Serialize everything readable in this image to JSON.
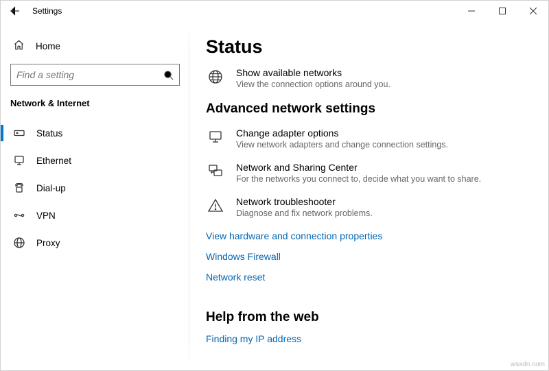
{
  "titlebar": {
    "title": "Settings"
  },
  "sidebar": {
    "home_label": "Home",
    "search_placeholder": "Find a setting",
    "category": "Network & Internet",
    "items": [
      {
        "label": "Status"
      },
      {
        "label": "Ethernet"
      },
      {
        "label": "Dial-up"
      },
      {
        "label": "VPN"
      },
      {
        "label": "Proxy"
      }
    ]
  },
  "main": {
    "page_title": "Status",
    "show_networks": {
      "title": "Show available networks",
      "desc": "View the connection options around you."
    },
    "advanced_heading": "Advanced network settings",
    "adapter": {
      "title": "Change adapter options",
      "desc": "View network adapters and change connection settings."
    },
    "sharing": {
      "title": "Network and Sharing Center",
      "desc": "For the networks you connect to, decide what you want to share."
    },
    "trouble": {
      "title": "Network troubleshooter",
      "desc": "Diagnose and fix network problems."
    },
    "links": {
      "hw": "View hardware and connection properties",
      "fw": "Windows Firewall",
      "reset": "Network reset"
    },
    "help_heading": "Help from the web",
    "help_link": "Finding my IP address"
  },
  "watermark": "wsxdn.com"
}
